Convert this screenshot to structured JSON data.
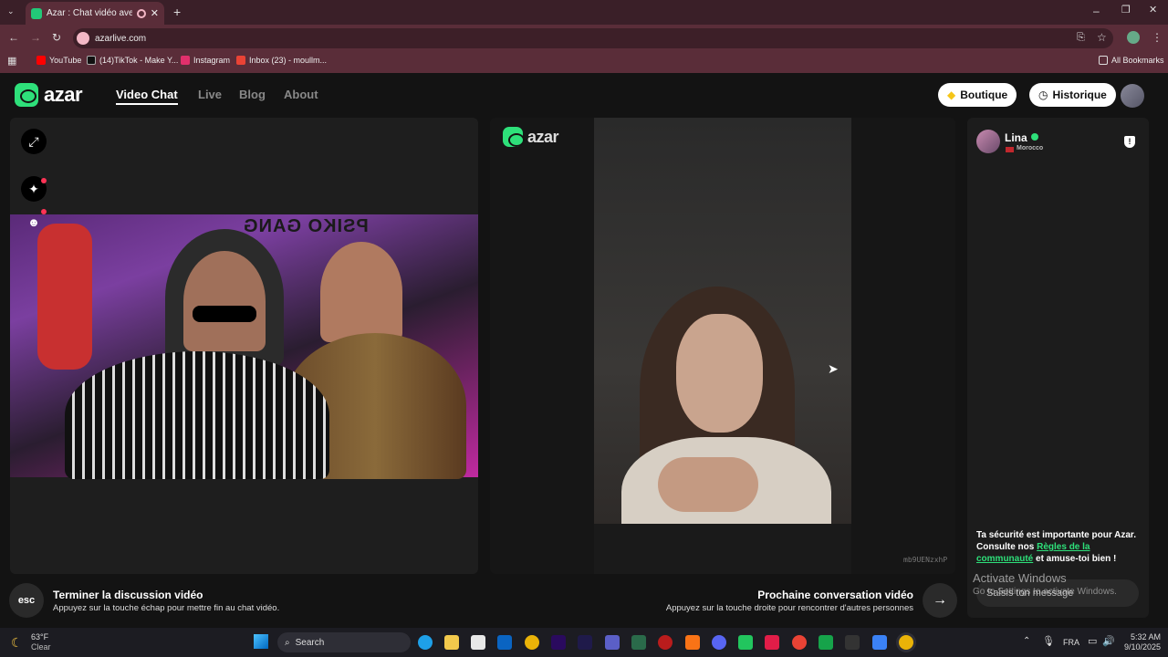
{
  "browser": {
    "tab_title": "Azar : Chat vidéo avec de n",
    "url": "azarlive.com",
    "bookmarks": [
      {
        "label": "YouTube",
        "color": "#ff0000"
      },
      {
        "label": "(14)TikTok - Make Y...",
        "color": "#111111"
      },
      {
        "label": "Instagram",
        "color": "#e1306c"
      },
      {
        "label": "Inbox (23) - moullm...",
        "color": "#ea4335"
      }
    ],
    "all_bookmarks": "All Bookmarks"
  },
  "header": {
    "logo": "azar",
    "nav": [
      "Video Chat",
      "Live",
      "Blog",
      "About"
    ],
    "boutique": "Boutique",
    "historique": "Historique"
  },
  "video": {
    "logo": "azar",
    "watermark": "mb9UENzxhP",
    "left_banner": "PSIKO GANG"
  },
  "chat": {
    "name": "Lina",
    "country": "Morocco",
    "safety_pre": "Ta sécurité est importante pour Azar. Consulte nos ",
    "safety_link": "Règles de la communauté",
    "safety_post": " et amuse-toi bien !",
    "input_placeholder": "Saisis ton message",
    "activate_title": "Activate Windows",
    "activate_sub": "Go to Settings to activate Windows."
  },
  "bottom": {
    "esc_key": "esc",
    "end_title": "Terminer la discussion vidéo",
    "end_sub": "Appuyez sur la touche échap pour mettre fin au chat vidéo.",
    "next_title": "Prochaine conversation vidéo",
    "next_sub": "Appuyez sur la touche droite pour rencontrer d'autres personnes"
  },
  "taskbar": {
    "temp": "63°F",
    "weather": "Clear",
    "search": "Search",
    "lang": "FRA",
    "time": "5:32 AM",
    "date": "9/10/2025"
  },
  "colors": {
    "accent": "#2ee07a",
    "link": "#2ee07a",
    "browser_frame": "#5a2d39"
  }
}
